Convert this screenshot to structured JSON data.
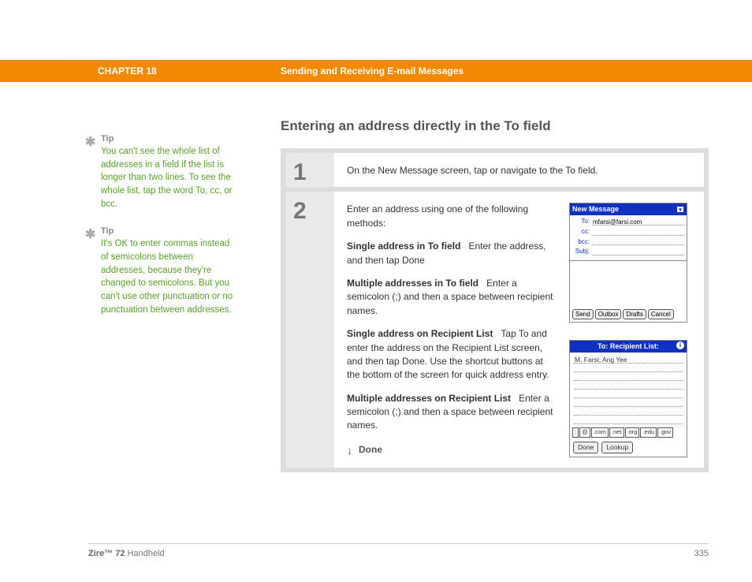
{
  "header": {
    "chapter": "CHAPTER 18",
    "title": "Sending and Receiving E-mail Messages"
  },
  "section_title": "Entering an address directly in the To field",
  "tips": [
    {
      "label": "Tip",
      "text": "You can't see the whole list of addresses in a field if the list is longer than two lines. To see the whole list, tap the word To, cc, or bcc."
    },
    {
      "label": "Tip",
      "text": "It's OK to enter commas instead of semicolons between addresses, because they're changed to semicolons. But you can't use other punctuation or no punctuation between addresses."
    }
  ],
  "steps": [
    {
      "num": "1",
      "text": "On the New Message screen, tap or navigate to the To field."
    },
    {
      "num": "2",
      "intro": "Enter an address using one of the following methods:",
      "methods": [
        {
          "head": "Single address in To field",
          "body": "Enter the address, and then tap Done"
        },
        {
          "head": "Multiple addresses in To field",
          "body": "Enter a semicolon (;) and then a space between recipient names."
        },
        {
          "head": "Single address on Recipient List",
          "body": "Tap To and enter the address on the Recipient List screen, and then tap Done. Use the shortcut buttons at the bottom of the screen for quick address entry."
        },
        {
          "head": "Multiple addresses on Recipient List",
          "body": "Enter a semicolon (;) and then a space between recipient names."
        }
      ],
      "done": "Done"
    }
  ],
  "mock1": {
    "title": "New Message",
    "rows": [
      {
        "label": "To:",
        "value": "mfarsi@farsi.com"
      },
      {
        "label": "cc:",
        "value": ""
      },
      {
        "label": "bcc:",
        "value": ""
      },
      {
        "label": "Subj:",
        "value": ""
      }
    ],
    "buttons": [
      "Send",
      "Outbox",
      "Drafts",
      "Cancel"
    ]
  },
  "mock2": {
    "title": "To: Recipient List:",
    "entry": "M. Farsi; Ang Yee",
    "shortcuts": [
      ";",
      "@",
      ".com",
      ".net",
      ".org",
      ".edu",
      ".gov"
    ],
    "buttons": [
      "Done",
      "Lookup"
    ]
  },
  "footer": {
    "product_bold": "Zire™ 72",
    "product_rest": " Handheld",
    "page": "335"
  }
}
